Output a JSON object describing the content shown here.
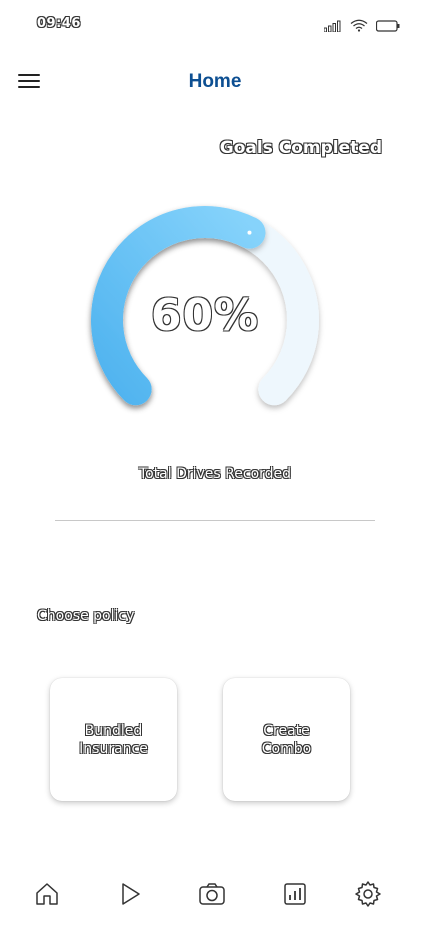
{
  "status_bar": {
    "time": "09:46",
    "icons": [
      "signal-icon",
      "wifi-icon",
      "battery-icon"
    ]
  },
  "header": {
    "title": "Home",
    "menu_icon": "hamburger-menu-icon"
  },
  "goals": {
    "heading": "Goals Completed",
    "value_text": "60%",
    "progress": 0.6,
    "caption": "Total Drives Recorded"
  },
  "policy": {
    "label": "Choose policy",
    "cards": [
      {
        "label": "Bundled Insurance"
      },
      {
        "label": "Create Combo"
      }
    ]
  },
  "bottom_nav": {
    "items": [
      "home-icon",
      "play-icon",
      "camera-icon",
      "chart-icon",
      "settings-icon"
    ]
  },
  "colors": {
    "title": "#0d4f92",
    "gauge_fill": "#5bbcf5",
    "gauge_track": "#eef7fd"
  }
}
